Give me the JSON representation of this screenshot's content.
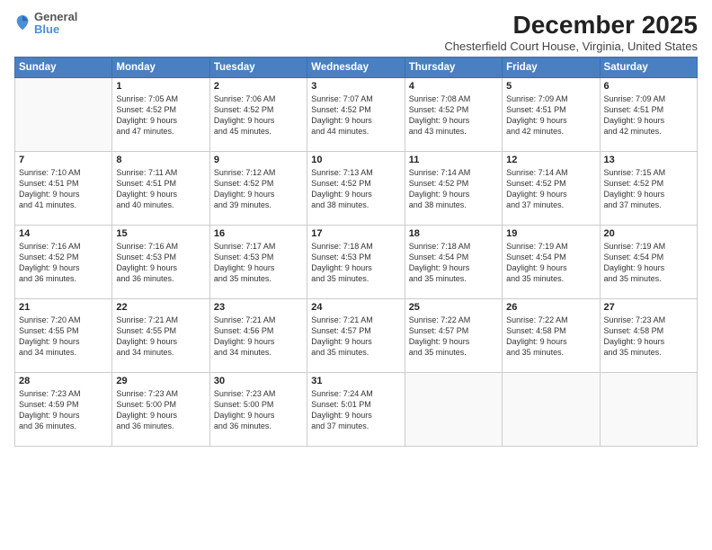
{
  "logo": {
    "general": "General",
    "blue": "Blue"
  },
  "title": "December 2025",
  "subtitle": "Chesterfield Court House, Virginia, United States",
  "days_of_week": [
    "Sunday",
    "Monday",
    "Tuesday",
    "Wednesday",
    "Thursday",
    "Friday",
    "Saturday"
  ],
  "weeks": [
    [
      {
        "day": "",
        "info": ""
      },
      {
        "day": "1",
        "info": "Sunrise: 7:05 AM\nSunset: 4:52 PM\nDaylight: 9 hours\nand 47 minutes."
      },
      {
        "day": "2",
        "info": "Sunrise: 7:06 AM\nSunset: 4:52 PM\nDaylight: 9 hours\nand 45 minutes."
      },
      {
        "day": "3",
        "info": "Sunrise: 7:07 AM\nSunset: 4:52 PM\nDaylight: 9 hours\nand 44 minutes."
      },
      {
        "day": "4",
        "info": "Sunrise: 7:08 AM\nSunset: 4:52 PM\nDaylight: 9 hours\nand 43 minutes."
      },
      {
        "day": "5",
        "info": "Sunrise: 7:09 AM\nSunset: 4:51 PM\nDaylight: 9 hours\nand 42 minutes."
      },
      {
        "day": "6",
        "info": "Sunrise: 7:09 AM\nSunset: 4:51 PM\nDaylight: 9 hours\nand 42 minutes."
      }
    ],
    [
      {
        "day": "7",
        "info": "Sunrise: 7:10 AM\nSunset: 4:51 PM\nDaylight: 9 hours\nand 41 minutes."
      },
      {
        "day": "8",
        "info": "Sunrise: 7:11 AM\nSunset: 4:51 PM\nDaylight: 9 hours\nand 40 minutes."
      },
      {
        "day": "9",
        "info": "Sunrise: 7:12 AM\nSunset: 4:52 PM\nDaylight: 9 hours\nand 39 minutes."
      },
      {
        "day": "10",
        "info": "Sunrise: 7:13 AM\nSunset: 4:52 PM\nDaylight: 9 hours\nand 38 minutes."
      },
      {
        "day": "11",
        "info": "Sunrise: 7:14 AM\nSunset: 4:52 PM\nDaylight: 9 hours\nand 38 minutes."
      },
      {
        "day": "12",
        "info": "Sunrise: 7:14 AM\nSunset: 4:52 PM\nDaylight: 9 hours\nand 37 minutes."
      },
      {
        "day": "13",
        "info": "Sunrise: 7:15 AM\nSunset: 4:52 PM\nDaylight: 9 hours\nand 37 minutes."
      }
    ],
    [
      {
        "day": "14",
        "info": "Sunrise: 7:16 AM\nSunset: 4:52 PM\nDaylight: 9 hours\nand 36 minutes."
      },
      {
        "day": "15",
        "info": "Sunrise: 7:16 AM\nSunset: 4:53 PM\nDaylight: 9 hours\nand 36 minutes."
      },
      {
        "day": "16",
        "info": "Sunrise: 7:17 AM\nSunset: 4:53 PM\nDaylight: 9 hours\nand 35 minutes."
      },
      {
        "day": "17",
        "info": "Sunrise: 7:18 AM\nSunset: 4:53 PM\nDaylight: 9 hours\nand 35 minutes."
      },
      {
        "day": "18",
        "info": "Sunrise: 7:18 AM\nSunset: 4:54 PM\nDaylight: 9 hours\nand 35 minutes."
      },
      {
        "day": "19",
        "info": "Sunrise: 7:19 AM\nSunset: 4:54 PM\nDaylight: 9 hours\nand 35 minutes."
      },
      {
        "day": "20",
        "info": "Sunrise: 7:19 AM\nSunset: 4:54 PM\nDaylight: 9 hours\nand 35 minutes."
      }
    ],
    [
      {
        "day": "21",
        "info": "Sunrise: 7:20 AM\nSunset: 4:55 PM\nDaylight: 9 hours\nand 34 minutes."
      },
      {
        "day": "22",
        "info": "Sunrise: 7:21 AM\nSunset: 4:55 PM\nDaylight: 9 hours\nand 34 minutes."
      },
      {
        "day": "23",
        "info": "Sunrise: 7:21 AM\nSunset: 4:56 PM\nDaylight: 9 hours\nand 34 minutes."
      },
      {
        "day": "24",
        "info": "Sunrise: 7:21 AM\nSunset: 4:57 PM\nDaylight: 9 hours\nand 35 minutes."
      },
      {
        "day": "25",
        "info": "Sunrise: 7:22 AM\nSunset: 4:57 PM\nDaylight: 9 hours\nand 35 minutes."
      },
      {
        "day": "26",
        "info": "Sunrise: 7:22 AM\nSunset: 4:58 PM\nDaylight: 9 hours\nand 35 minutes."
      },
      {
        "day": "27",
        "info": "Sunrise: 7:23 AM\nSunset: 4:58 PM\nDaylight: 9 hours\nand 35 minutes."
      }
    ],
    [
      {
        "day": "28",
        "info": "Sunrise: 7:23 AM\nSunset: 4:59 PM\nDaylight: 9 hours\nand 36 minutes."
      },
      {
        "day": "29",
        "info": "Sunrise: 7:23 AM\nSunset: 5:00 PM\nDaylight: 9 hours\nand 36 minutes."
      },
      {
        "day": "30",
        "info": "Sunrise: 7:23 AM\nSunset: 5:00 PM\nDaylight: 9 hours\nand 36 minutes."
      },
      {
        "day": "31",
        "info": "Sunrise: 7:24 AM\nSunset: 5:01 PM\nDaylight: 9 hours\nand 37 minutes."
      },
      {
        "day": "",
        "info": ""
      },
      {
        "day": "",
        "info": ""
      },
      {
        "day": "",
        "info": ""
      }
    ]
  ]
}
